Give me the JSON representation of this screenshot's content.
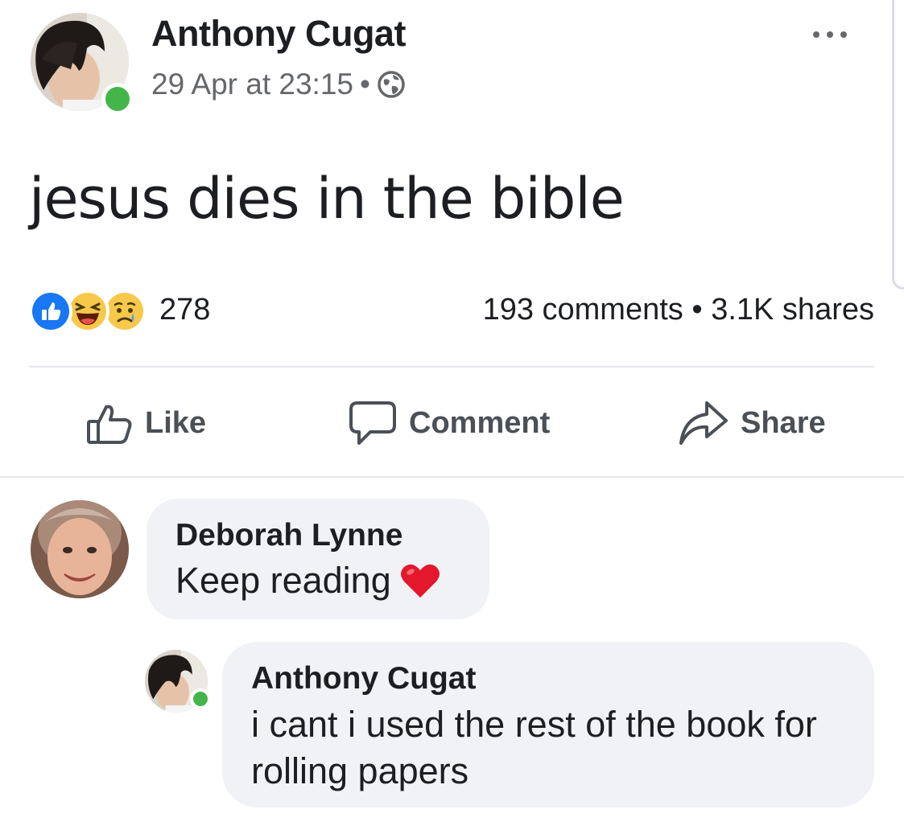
{
  "post": {
    "author": "Anthony Cugat",
    "timestamp": "29 Apr at 23:15",
    "meta_separator": "•",
    "visibility_icon": "globe-icon",
    "options_icon": "more-icon",
    "text": "jesus dies in the bible",
    "reactions": {
      "icons": [
        "like-reaction-icon",
        "haha-reaction-icon",
        "sad-reaction-icon"
      ],
      "count": "278"
    },
    "stats": "193 comments • 3.1K shares"
  },
  "actions": {
    "like_label": "Like",
    "comment_label": "Comment",
    "share_label": "Share"
  },
  "comments": [
    {
      "author": "Deborah Lynne",
      "text": "Keep reading",
      "emoji": "heart-icon"
    },
    {
      "author": "Anthony Cugat",
      "text": "i cant i used the rest of the book for rolling papers",
      "online": true
    }
  ],
  "colors": {
    "like_blue": "#1877f2",
    "online_green": "#44b54a",
    "bubble_bg": "#f0f2f5",
    "secondary_text": "#65676b"
  }
}
